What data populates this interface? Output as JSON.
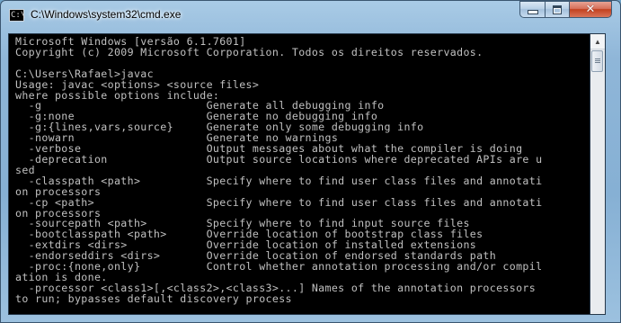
{
  "window": {
    "title": "C:\\Windows\\system32\\cmd.exe"
  },
  "controls": {
    "minimize": "minimize",
    "maximize": "maximize",
    "close": "close"
  },
  "icons": {
    "app": "cmd-icon",
    "minimize": "minimize-icon",
    "maximize": "maximize-icon",
    "close": "close-icon",
    "scroll_up": "arrow-up-icon"
  },
  "console": {
    "lines": [
      "Microsoft Windows [versão 6.1.7601]",
      "Copyright (c) 2009 Microsoft Corporation. Todos os direitos reservados.",
      "",
      "C:\\Users\\Rafael>javac",
      "Usage: javac <options> <source files>",
      "where possible options include:",
      "  -g                         Generate all debugging info",
      "  -g:none                    Generate no debugging info",
      "  -g:{lines,vars,source}     Generate only some debugging info",
      "  -nowarn                    Generate no warnings",
      "  -verbose                   Output messages about what the compiler is doing",
      "  -deprecation               Output source locations where deprecated APIs are u",
      "sed",
      "  -classpath <path>          Specify where to find user class files and annotati",
      "on processors",
      "  -cp <path>                 Specify where to find user class files and annotati",
      "on processors",
      "  -sourcepath <path>         Specify where to find input source files",
      "  -bootclasspath <path>      Override location of bootstrap class files",
      "  -extdirs <dirs>            Override location of installed extensions",
      "  -endorseddirs <dirs>       Override location of endorsed standards path",
      "  -proc:{none,only}          Control whether annotation processing and/or compil",
      "ation is done.",
      "  -processor <class1>[,<class2>,<class3>...] Names of the annotation processors",
      "to run; bypasses default discovery process"
    ]
  }
}
